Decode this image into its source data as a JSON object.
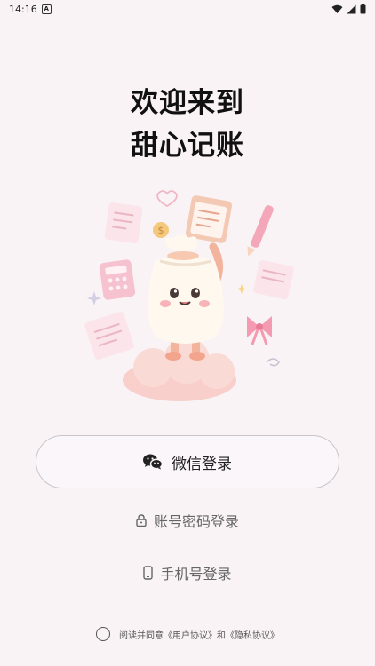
{
  "status_bar": {
    "time": "14:16",
    "notification_badge": "A"
  },
  "title": {
    "line1": "欢迎来到",
    "line2": "甜心记账"
  },
  "hero": {
    "icon": "mascot-illustration"
  },
  "login": {
    "wechat_label": "微信登录",
    "password_label": "账号密码登录",
    "phone_label": "手机号登录"
  },
  "agreement": {
    "text": "阅读并同意《用户协议》和《隐私协议》"
  },
  "colors": {
    "background": "#F9F3F6",
    "pink_accent": "#F4A7B9",
    "button_border": "#C9C5C8"
  }
}
